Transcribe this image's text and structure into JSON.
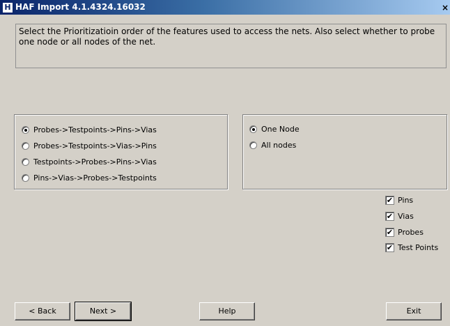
{
  "window": {
    "title": "HAF Import 4.1.4324.16032",
    "icon_letter": "H",
    "close_glyph": "×"
  },
  "instructions": "Select the Prioritizatioin order of the features used to access the nets. Also select whether to probe one node or all nodes of the net.",
  "order_options": [
    {
      "label": "Probes->Testpoints->Pins->Vias",
      "selected": true
    },
    {
      "label": "Probes->Testpoints->Vias->Pins",
      "selected": false
    },
    {
      "label": "Testpoints->Probes->Pins->Vias",
      "selected": false
    },
    {
      "label": "Pins->Vias->Probes->Testpoints",
      "selected": false
    }
  ],
  "node_options": [
    {
      "label": "One Node",
      "selected": true
    },
    {
      "label": "All nodes",
      "selected": false
    }
  ],
  "features": [
    {
      "label": "Pins",
      "checked": true
    },
    {
      "label": "Vias",
      "checked": true
    },
    {
      "label": "Probes",
      "checked": true
    },
    {
      "label": "Test Points",
      "checked": true
    }
  ],
  "buttons": {
    "back": "< Back",
    "next": "Next >",
    "help": "Help",
    "exit": "Exit"
  }
}
